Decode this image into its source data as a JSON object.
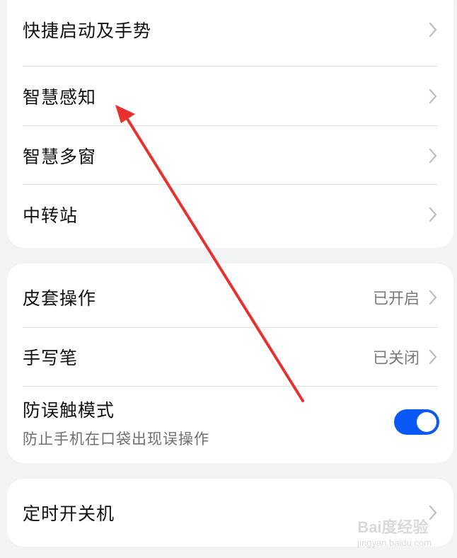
{
  "group1": {
    "items": [
      {
        "label": "快捷启动及手势"
      },
      {
        "label": "智慧感知"
      },
      {
        "label": "智慧多窗"
      },
      {
        "label": "中转站"
      }
    ]
  },
  "group2": {
    "cover": {
      "label": "皮套操作",
      "value": "已开启"
    },
    "stylus": {
      "label": "手写笔",
      "value": "已关闭"
    },
    "mistouch": {
      "label": "防误触模式",
      "description": "防止手机在口袋出现误操作",
      "toggle_on": true
    }
  },
  "group3": {
    "items": [
      {
        "label": "定时开关机"
      }
    ]
  },
  "watermark": {
    "brand": "Bai度经验",
    "site": "jingyan.baidu.com"
  },
  "colors": {
    "accent": "#0a59f7",
    "annotation_arrow": "#e8312f",
    "background": "#f1f3f5"
  },
  "icons": {
    "chevron": "chevron-right-icon",
    "annotation": "red-arrow-annotation"
  }
}
